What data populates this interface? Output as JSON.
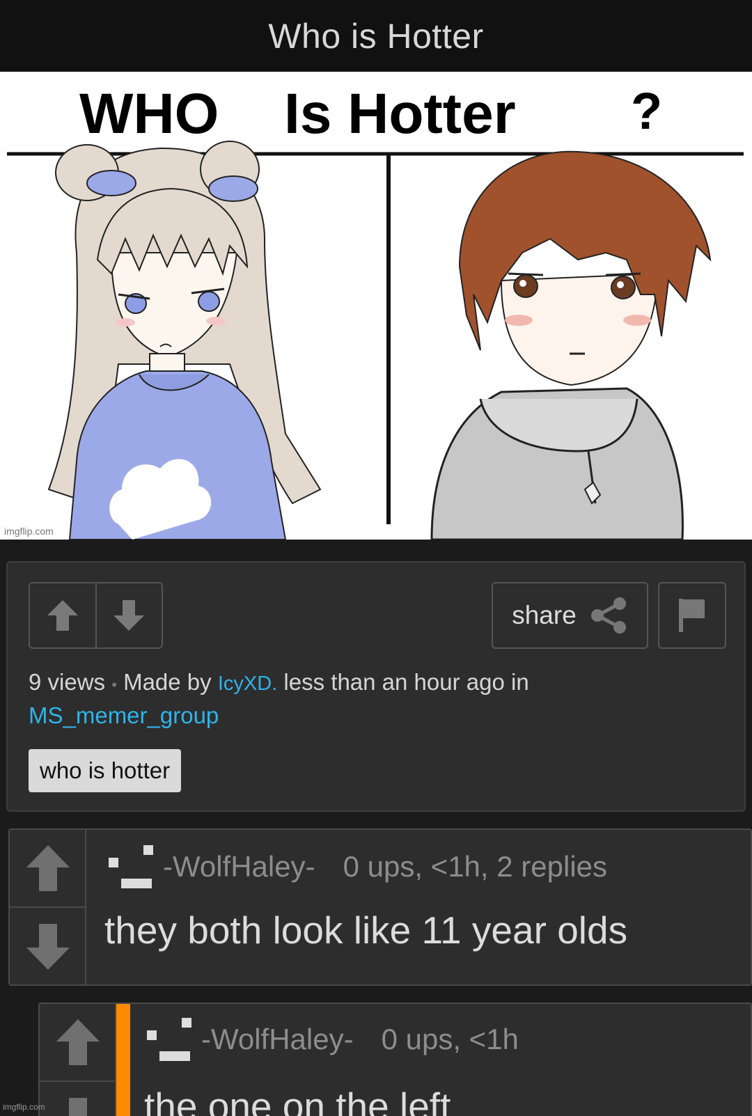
{
  "header": {
    "title": "Who is Hotter"
  },
  "meme": {
    "title_parts": [
      "WHO",
      "Is Hotter",
      "?"
    ],
    "watermark": "imgflip.com"
  },
  "actions": {
    "share_label": "share",
    "upvote_icon": "up-arrow-icon",
    "downvote_icon": "down-arrow-icon",
    "share_icon": "share-icon",
    "flag_icon": "flag-icon"
  },
  "meta": {
    "views": "9 views",
    "separator": "•",
    "made_by": "Made by",
    "author": "IcyXD.",
    "time_text": "less than an hour ago in",
    "stream": "MS_memer_group"
  },
  "tags": [
    "who is hotter"
  ],
  "comments": [
    {
      "username": "-WolfHaley-",
      "stats": "0 ups, <1h, 2 replies",
      "text": "they both look like 11 year olds"
    },
    {
      "username": "-WolfHaley-",
      "stats": "0 ups, <1h",
      "text": "the one on the left"
    }
  ],
  "footer_watermark": "imgflip.com",
  "colors": {
    "background": "#1b1b1b",
    "panel": "#2d2d2d",
    "link": "#2eb4ea",
    "reply_accent": "#ff8a00",
    "tag_bg": "#dadada"
  }
}
